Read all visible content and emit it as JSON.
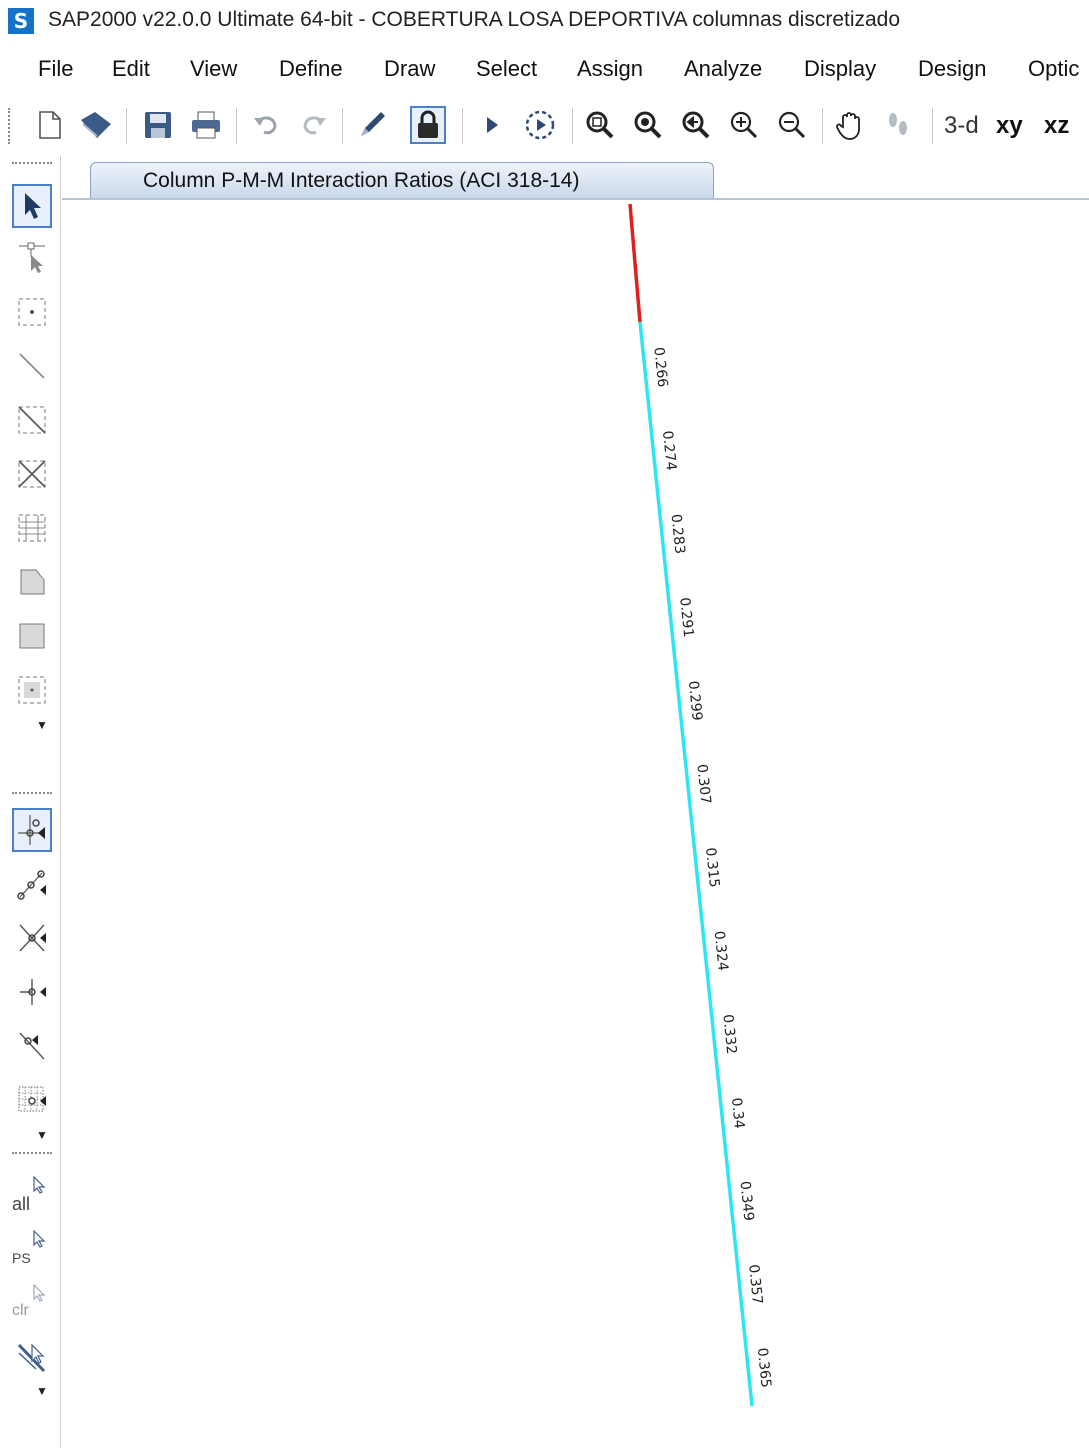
{
  "window": {
    "app_icon": "S",
    "title": "SAP2000 v22.0.0 Ultimate 64-bit - COBERTURA LOSA DEPORTIVA columnas discretizado"
  },
  "menu": [
    "File",
    "Edit",
    "View",
    "Define",
    "Draw",
    "Select",
    "Assign",
    "Analyze",
    "Display",
    "Design",
    "Optic"
  ],
  "toolbar": {
    "view_3d": "3-d",
    "view_xy": "xy",
    "view_xz": "xz"
  },
  "left_toolbar": {
    "select_all": "all",
    "select_previous": "PS",
    "clear_selection": "clr"
  },
  "view_tab": {
    "label": "Column P-M-M Interaction Ratios  (ACI 318-14)"
  },
  "colors": {
    "element_red": "#e0201c",
    "element_cyan": "#2ee6f2",
    "tab_blue": "#c9d7ea",
    "app_icon_blue": "#1473c9"
  },
  "ratios": [
    "0.266",
    "0.274",
    "0.283",
    "0.291",
    "0.299",
    "0.307",
    "0.315",
    "0.324",
    "0.332",
    "0.34",
    "0.349",
    "0.357",
    "0.365"
  ]
}
